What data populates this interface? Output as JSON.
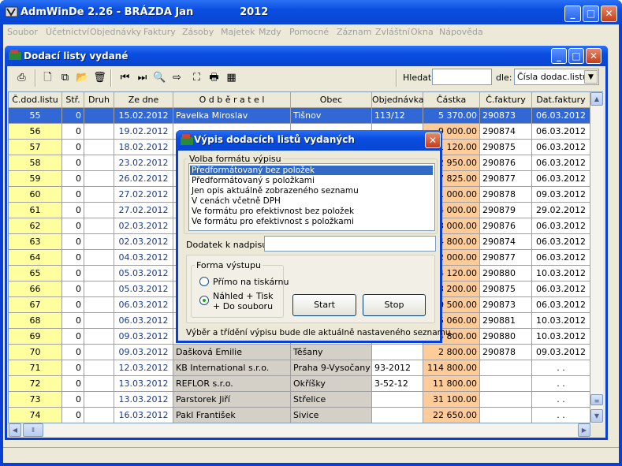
{
  "app": {
    "title": "AdmWinDe 2.26 - BRÁZDA Jan             2012",
    "icon": "app-logo-icon"
  },
  "menu": [
    "Soubor",
    "Účetnictví",
    "Objednávky",
    "Faktury",
    "Zásoby",
    "Majetek",
    "Mzdy",
    "Pomocné",
    "Záznam",
    "Zvláštní",
    "Okna",
    "Nápověda"
  ],
  "child": {
    "title": "Dodací listy vydané",
    "search_label": "Hledat:",
    "search_value": "",
    "dle_label": "dle:",
    "sort_value": "Čísla dodac.listu"
  },
  "toolbar_icons": [
    "print-icon",
    "new-document-icon",
    "copy-icon",
    "open-folder-icon",
    "delete-icon",
    "first-record-icon",
    "last-record-icon",
    "search-icon",
    "arrow-right-icon",
    "fit-icon",
    "printer-icon",
    "export-excel-icon"
  ],
  "grid": {
    "columns": [
      "Č.dod.listu",
      "Stř.",
      "Druh",
      "Ze dne",
      "O d b ě r a t e l",
      "Obec",
      "Objednávka",
      "Částka",
      "Č.faktury",
      "Dat.faktury"
    ],
    "rows": [
      [
        "55",
        "0",
        "",
        "15.02.2012",
        "Pavelka Miroslav",
        "Tišnov",
        "113/12",
        "5 370.00",
        "290873",
        "06.03.2012"
      ],
      [
        "56",
        "0",
        "",
        "19.02.2012",
        "",
        "",
        "",
        "9 000.00",
        "290874",
        "06.03.2012"
      ],
      [
        "57",
        "0",
        "",
        "18.02.2012",
        "",
        "",
        "",
        "1 120.00",
        "290875",
        "06.03.2012"
      ],
      [
        "58",
        "0",
        "",
        "23.02.2012",
        "",
        "",
        "",
        "2 950.00",
        "290876",
        "06.03.2012"
      ],
      [
        "59",
        "0",
        "",
        "26.02.2012",
        "",
        "",
        "",
        "7 825.00",
        "290877",
        "06.03.2012"
      ],
      [
        "60",
        "0",
        "",
        "27.02.2012",
        "",
        "",
        "",
        "1 000.00",
        "290878",
        "09.03.2012"
      ],
      [
        "61",
        "0",
        "",
        "27.02.2012",
        "",
        "",
        "",
        "4 000.00",
        "290879",
        "29.02.2012"
      ],
      [
        "62",
        "0",
        "",
        "02.03.2012",
        "",
        "",
        "",
        "3 000.00",
        "290876",
        "06.03.2012"
      ],
      [
        "63",
        "0",
        "",
        "02.03.2012",
        "",
        "",
        "",
        "4 800.00",
        "290874",
        "06.03.2012"
      ],
      [
        "64",
        "0",
        "",
        "04.03.2012",
        "",
        "",
        "",
        "2 000.00",
        "290877",
        "06.03.2012"
      ],
      [
        "65",
        "0",
        "",
        "05.03.2012",
        "",
        "",
        "",
        "4 120.00",
        "290880",
        "10.03.2012"
      ],
      [
        "66",
        "0",
        "",
        "05.03.2012",
        "",
        "",
        "",
        "3 200.00",
        "290875",
        "06.03.2012"
      ],
      [
        "67",
        "0",
        "",
        "06.03.2012",
        "",
        "",
        "",
        "0 500.00",
        "290873",
        "06.03.2012"
      ],
      [
        "68",
        "0",
        "",
        "06.03.2012",
        "",
        "",
        "",
        "5 060.00",
        "290881",
        "10.03.2012"
      ],
      [
        "69",
        "0",
        "",
        "09.03.2012",
        "",
        "",
        "",
        "4 800.00",
        "290880",
        "10.03.2012"
      ],
      [
        "70",
        "0",
        "",
        "09.03.2012",
        "Dašková Emilie",
        "Těšany",
        "",
        "2 800.00",
        "290878",
        "09.03.2012"
      ],
      [
        "71",
        "0",
        "",
        "12.03.2012",
        "KB International s.r.o.",
        "Praha 9-Vysočany",
        "93-2012",
        "114 800.00",
        "",
        ". ."
      ],
      [
        "72",
        "0",
        "",
        "13.03.2012",
        "REFLOR s.r.o.",
        "Okříšky",
        "3-52-12",
        "11 800.00",
        "",
        ". ."
      ],
      [
        "73",
        "0",
        "",
        "13.03.2012",
        "Parstorek Jiří",
        "Střelice",
        "",
        "31 100.00",
        "",
        ". ."
      ],
      [
        "74",
        "0",
        "",
        "16.03.2012",
        "Pakl František",
        "Sivice",
        "",
        "22 650.00",
        "",
        ". ."
      ]
    ]
  },
  "dialog": {
    "title": "Výpis dodacích listů vydaných",
    "format_group": "Volba formátu výpisu",
    "formats": [
      "Předformátovaný bez položek",
      "Předformátovaný s položkami",
      "Jen opis aktuálně zobrazeného seznamu",
      "V cenách včetně DPH",
      "Ve formátu pro efektivnost bez položek",
      "Ve formátu pro efektivnost s položkami"
    ],
    "selected_format": 0,
    "dodatek_label": "Dodatek k nadpisu:",
    "dodatek_value": "",
    "output_group": "Forma výstupu",
    "radio_printer": "Přímo na tiskárnu",
    "radio_preview_line1": "Náhled + Tisk",
    "radio_preview_line2": "+ Do souboru",
    "selected_output": "preview",
    "start_label": "Start",
    "stop_label": "Stop",
    "note": "Výběr a třídění výpisu bude dle aktuálně nastaveného seznamu."
  },
  "colors": {
    "titlebar": "#0a4de0",
    "selected_row": "#3168d5",
    "number_col": "#ffffa0",
    "amount_col": "#ffcc99"
  }
}
